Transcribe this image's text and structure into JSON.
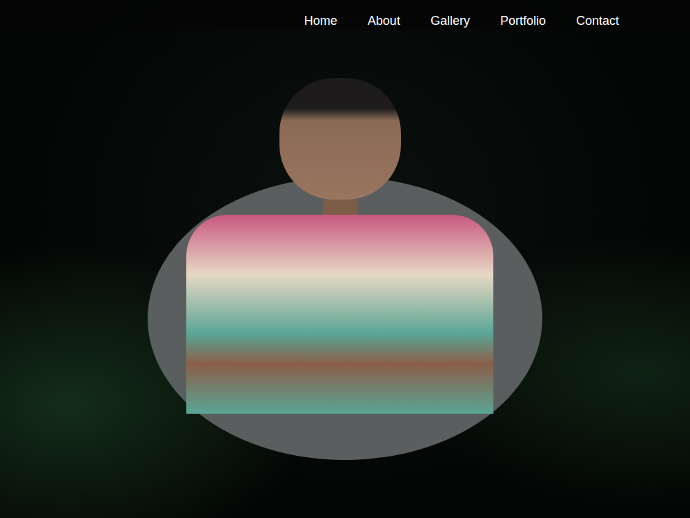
{
  "nav": {
    "items": [
      {
        "label": "Home"
      },
      {
        "label": "About"
      },
      {
        "label": "Gallery"
      },
      {
        "label": "Portfolio"
      },
      {
        "label": "Contact"
      }
    ]
  }
}
